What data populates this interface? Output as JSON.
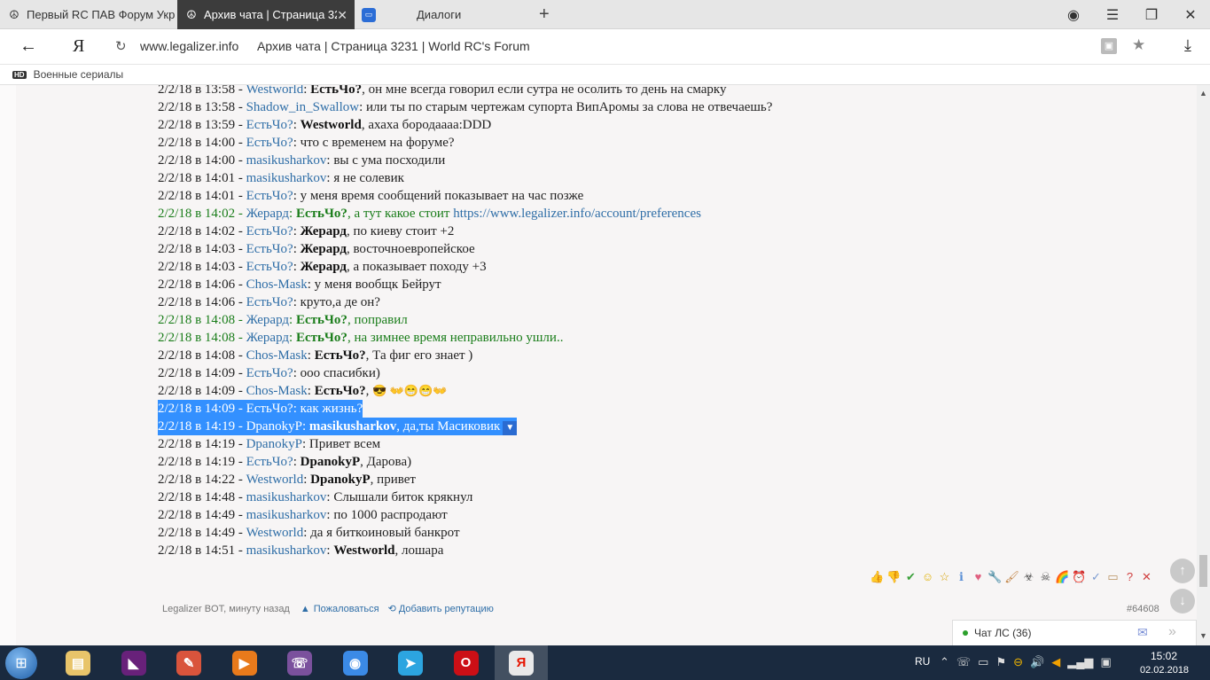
{
  "tabs": [
    {
      "title": "Первый RC ПАВ Форум Укр",
      "icon": "peace-icon"
    },
    {
      "title": "Архив чата | Страница 3231",
      "icon": "peace-icon"
    },
    {
      "title": "Диалоги",
      "icon": "chat-icon"
    }
  ],
  "address": {
    "domain": "www.legalizer.info",
    "page_title": "Архив чата | Страница 3231 | World RC's Forum",
    "yandex_logo": "Я"
  },
  "bookmarks": [
    {
      "label": "Военные сериалы",
      "badge": "HD"
    }
  ],
  "chat": [
    {
      "ts": "2/2/18 в 13:58",
      "user": "Westworld",
      "to": "ЕстьЧо?",
      "text": ", он мне всегда говорил если сутра не осолить то день на смарку"
    },
    {
      "ts": "2/2/18 в 13:58",
      "user": "Shadow_in_Swallow",
      "text": ": или ты по старым чертежам супорта ВипАромы за слова не отвечаешь?"
    },
    {
      "ts": "2/2/18 в 13:59",
      "user": "ЕстьЧо?",
      "to": "Westworld",
      "text": ", ахаха бородаааа:DDD"
    },
    {
      "ts": "2/2/18 в 14:00",
      "user": "ЕстьЧо?",
      "text": ": что с временем на форуме?"
    },
    {
      "ts": "2/2/18 в 14:00",
      "user": "masikusharkov",
      "text": ": вы с ума посходили"
    },
    {
      "ts": "2/2/18 в 14:01",
      "user": "masikusharkov",
      "text": ": я не солевик"
    },
    {
      "ts": "2/2/18 в 14:01",
      "user": "ЕстьЧо?",
      "text": ": у меня время сообщений показывает на час позже"
    },
    {
      "ts": "2/2/18 в 14:02",
      "user": "Жерард",
      "to": "ЕстьЧо?",
      "text": ", а тут какое стоит ",
      "link": "https://www.legalizer.info/account/preferences",
      "green": true
    },
    {
      "ts": "2/2/18 в 14:02",
      "user": "ЕстьЧо?",
      "to": "Жерард",
      "text": ", по киеву стоит +2"
    },
    {
      "ts": "2/2/18 в 14:03",
      "user": "ЕстьЧо?",
      "to": "Жерард",
      "text": ", восточноевропейское"
    },
    {
      "ts": "2/2/18 в 14:03",
      "user": "ЕстьЧо?",
      "to": "Жерард",
      "text": ", а показывает походу +3"
    },
    {
      "ts": "2/2/18 в 14:06",
      "user": "Chos-Mask",
      "text": ": у меня вообщк Бейрут"
    },
    {
      "ts": "2/2/18 в 14:06",
      "user": "ЕстьЧо?",
      "text": ": круто,а де он?"
    },
    {
      "ts": "2/2/18 в 14:08",
      "user": "Жерард",
      "to": "ЕстьЧо?",
      "text": ", поправил",
      "green": true
    },
    {
      "ts": "2/2/18 в 14:08",
      "user": "Жерард",
      "to": "ЕстьЧо?",
      "text": ", на зимнее время неправильно ушли..",
      "green": true
    },
    {
      "ts": "2/2/18 в 14:08",
      "user": "Chos-Mask",
      "to": "ЕстьЧо?",
      "text": ", Та фиг его знает )"
    },
    {
      "ts": "2/2/18 в 14:09",
      "user": "ЕстьЧо?",
      "text": ": ооо спасибки)"
    },
    {
      "ts": "2/2/18 в 14:09",
      "user": "Chos-Mask",
      "to": "ЕстьЧо?",
      "text": ", ",
      "smiles": "😎 👐😁😁👐"
    },
    {
      "ts": "2/2/18 в 14:09",
      "user": "ЕстьЧо?",
      "text": ": как жизнь?",
      "selected": true
    },
    {
      "ts": "2/2/18 в 14:19",
      "user": "DpanokyP",
      "to": "masikusharkov",
      "text": ", да,ты Масиковик",
      "selected": true
    },
    {
      "ts": "2/2/18 в 14:19",
      "user": "DpanokyP",
      "text": ": Привет всем"
    },
    {
      "ts": "2/2/18 в 14:19",
      "user": "ЕстьЧо?",
      "to": "DpanokyP",
      "text": ", Дарова)"
    },
    {
      "ts": "2/2/18 в 14:22",
      "user": "Westworld",
      "to": "DpanokyP",
      "text": ", привет"
    },
    {
      "ts": "2/2/18 в 14:48",
      "user": "masikusharkov",
      "text": ": Слышали биток крякнул"
    },
    {
      "ts": "2/2/18 в 14:49",
      "user": "masikusharkov",
      "text": ": по 1000 распродают"
    },
    {
      "ts": "2/2/18 в 14:49",
      "user": "Westworld",
      "text": ": да я биткоиновый банкрот"
    },
    {
      "ts": "2/2/18 в 14:51",
      "user": "masikusharkov",
      "to": "Westworld",
      "text": ", лошара"
    }
  ],
  "reaction_icons": [
    "👍",
    "👎",
    "✔",
    "☺",
    "☆",
    "ℹ",
    "♥",
    "🔧",
    "🖌",
    "☣",
    "☠",
    "🌈",
    "⏰",
    "✓",
    "▭",
    "?",
    "✕"
  ],
  "footer": {
    "author": "Legalizer BOT, минуту назад",
    "report": "Пожаловаться",
    "reputation": "Добавить репутацию",
    "post_id": "#64608"
  },
  "chat_widget": {
    "label": "Чат ЛС (36)"
  },
  "taskbar": {
    "lang": "RU",
    "time": "15:02",
    "date": "02.02.2018",
    "apps": [
      {
        "name": "explorer",
        "color": "#e8c46a",
        "glyph": "▤"
      },
      {
        "name": "visual-studio",
        "color": "#68217a",
        "glyph": "◣"
      },
      {
        "name": "paint",
        "color": "#d9543c",
        "glyph": "✎"
      },
      {
        "name": "media-player",
        "color": "#e87a1b",
        "glyph": "▶"
      },
      {
        "name": "viber",
        "color": "#7b519d",
        "glyph": "☏"
      },
      {
        "name": "chrome",
        "color": "#3b8ae6",
        "glyph": "◉"
      },
      {
        "name": "telegram",
        "color": "#2ca5e0",
        "glyph": "➤"
      },
      {
        "name": "opera",
        "color": "#cc0f16",
        "glyph": "O"
      },
      {
        "name": "yandex",
        "color": "#e9e9e9",
        "glyph": "Я"
      }
    ]
  }
}
